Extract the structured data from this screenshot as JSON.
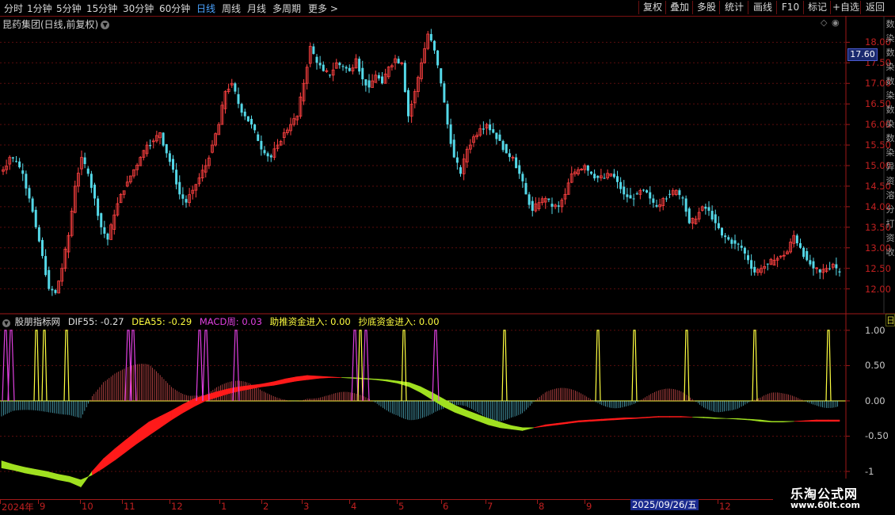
{
  "toolbar": {
    "periods": [
      "分时",
      "1分钟",
      "5分钟",
      "15分钟",
      "30分钟",
      "60分钟",
      "日线",
      "周线",
      "月线",
      "多周期",
      "更多 >"
    ],
    "active_period": "日线",
    "right_buttons": [
      "复权",
      "叠加",
      "多股",
      "统计",
      "画线",
      "F10",
      "标记",
      "+自选",
      "返回"
    ]
  },
  "chart_title": "昆药集团(日线,前复权)",
  "current_price_label": "17.60",
  "right_strip_glyphs": [
    "数",
    "染",
    "数",
    "染",
    "数",
    "染",
    "数",
    "染",
    "数",
    "染",
    "异",
    "资",
    "溶",
    "分",
    "打",
    "资",
    "收"
  ],
  "indicator_corner_glyph": "日",
  "indicator": {
    "name": "股朋指标网",
    "dif": "DIF55: -0.27",
    "dea": "DEA55: -0.29",
    "macd_week": "MACD周: 0.03",
    "push_fund": "助推资金进入: 0.00",
    "bottom_fund": "抄底资金进入: 0.00",
    "colors": {
      "name": "#e0e0e0",
      "dif": "#e0e0e0",
      "dea": "#ffff40",
      "macd_week": "#e040e0",
      "push_fund": "#ffff40",
      "bottom_fund": "#ffff40"
    }
  },
  "x_axis": {
    "labels": [
      "2024年",
      "9",
      "10",
      "11",
      "12",
      "1",
      "2",
      "3",
      "4",
      "5",
      "6",
      "7",
      "8",
      "9",
      "12"
    ],
    "highlight": "2025/09/26/五"
  },
  "watermark": {
    "line1": "乐淘公式网",
    "line2": "www.60lt.com"
  },
  "colors": {
    "up": "#ff4040",
    "down": "#54d8e8",
    "bg": "#000000",
    "axis": "#a01818",
    "band_up": "#ff1a1a",
    "band_down": "#a0e020",
    "signal_yellow": "#ffff40",
    "signal_magenta": "#e040e0"
  },
  "chart_data": [
    {
      "type": "candlestick",
      "title": "昆药集团(日线,前复权)",
      "y_ticks": [
        "18.00",
        "17.50",
        "17.00",
        "16.50",
        "16.00",
        "15.50",
        "15.00",
        "14.50",
        "14.00",
        "13.50",
        "13.00",
        "12.50",
        "12.00"
      ],
      "ylim": [
        11.55,
        18.45
      ],
      "last_price": 12.35,
      "close_series": [
        14.9,
        15.2,
        15.1,
        14.8,
        14.2,
        13.5,
        12.8,
        12.0,
        11.9,
        12.5,
        13.3,
        14.5,
        15.2,
        14.8,
        14.2,
        13.5,
        13.2,
        13.8,
        14.3,
        14.6,
        14.9,
        15.2,
        15.5,
        15.6,
        15.8,
        15.3,
        14.9,
        14.3,
        14.1,
        14.4,
        14.7,
        15.0,
        15.5,
        16.0,
        16.8,
        17.0,
        16.5,
        16.2,
        16.0,
        15.6,
        15.3,
        15.2,
        15.5,
        15.8,
        16.0,
        16.2,
        17.0,
        17.9,
        17.5,
        17.3,
        17.2,
        17.5,
        17.4,
        17.3,
        17.6,
        17.1,
        16.9,
        17.2,
        17.0,
        17.4,
        17.6,
        17.5,
        16.2,
        16.8,
        17.5,
        18.2,
        17.8,
        17.0,
        16.0,
        15.2,
        14.8,
        15.4,
        15.7,
        15.9,
        16.0,
        15.8,
        15.6,
        15.3,
        15.2,
        14.8,
        14.3,
        13.9,
        14.1,
        14.2,
        14.0,
        14.0,
        14.3,
        14.8,
        14.9,
        15.0,
        14.8,
        14.7,
        14.7,
        14.8,
        14.6,
        14.3,
        14.2,
        14.3,
        14.4,
        14.2,
        14.0,
        14.2,
        14.3,
        14.4,
        14.2,
        13.6,
        13.7,
        14.0,
        13.9,
        13.6,
        13.3,
        13.2,
        13.1,
        13.0,
        12.7,
        12.4,
        12.5,
        12.6,
        12.7,
        12.8,
        12.9,
        13.3,
        13.0,
        12.7,
        12.5,
        12.4,
        12.5,
        12.6,
        12.4
      ]
    },
    {
      "type": "indicator",
      "y_ticks": [
        "1.00",
        "0.50",
        "0.00",
        "-0.50",
        "-1"
      ],
      "ylim": [
        -1.0,
        1.1
      ],
      "series": [
        {
          "name": "DIF55",
          "value": -0.27
        },
        {
          "name": "DEA55",
          "value": -0.29
        },
        {
          "name": "MACD周",
          "value": 0.03
        },
        {
          "name": "助推资金进入",
          "value": 0.0
        },
        {
          "name": "抄底资金进入",
          "value": 0.0
        }
      ],
      "dif_series": [
        -0.95,
        -0.98,
        -1.02,
        -1.05,
        -1.08,
        -1.12,
        -1.15,
        -1.22,
        -1.0,
        -0.82,
        -0.68,
        -0.55,
        -0.42,
        -0.3,
        -0.22,
        -0.14,
        -0.05,
        0.03,
        0.08,
        0.13,
        0.17,
        0.2,
        0.22,
        0.24,
        0.27,
        0.31,
        0.34,
        0.36,
        0.35,
        0.34,
        0.33,
        0.32,
        0.31,
        0.3,
        0.28,
        0.25,
        0.2,
        0.12,
        0.02,
        -0.08,
        -0.16,
        -0.22,
        -0.28,
        -0.34,
        -0.38,
        -0.4,
        -0.42,
        -0.38,
        -0.34,
        -0.32,
        -0.3,
        -0.28,
        -0.27,
        -0.26,
        -0.25,
        -0.24,
        -0.24,
        -0.23,
        -0.22,
        -0.22,
        -0.22,
        -0.23,
        -0.24,
        -0.25,
        -0.25,
        -0.26,
        -0.27,
        -0.29,
        -0.3,
        -0.3,
        -0.29,
        -0.28,
        -0.27,
        -0.27,
        -0.27
      ],
      "dea_series": [
        -0.85,
        -0.9,
        -0.94,
        -0.97,
        -1.0,
        -1.04,
        -1.07,
        -1.12,
        -1.05,
        -0.95,
        -0.84,
        -0.72,
        -0.6,
        -0.49,
        -0.38,
        -0.27,
        -0.17,
        -0.08,
        0.0,
        0.05,
        0.1,
        0.14,
        0.17,
        0.2,
        0.22,
        0.25,
        0.28,
        0.3,
        0.32,
        0.33,
        0.33,
        0.33,
        0.32,
        0.31,
        0.3,
        0.28,
        0.26,
        0.2,
        0.12,
        0.03,
        -0.06,
        -0.13,
        -0.19,
        -0.25,
        -0.3,
        -0.35,
        -0.38,
        -0.38,
        -0.36,
        -0.34,
        -0.32,
        -0.3,
        -0.29,
        -0.28,
        -0.27,
        -0.26,
        -0.25,
        -0.24,
        -0.23,
        -0.23,
        -0.23,
        -0.23,
        -0.23,
        -0.24,
        -0.25,
        -0.25,
        -0.26,
        -0.27,
        -0.29,
        -0.29,
        -0.29,
        -0.29,
        -0.29,
        -0.29,
        -0.29
      ]
    }
  ]
}
